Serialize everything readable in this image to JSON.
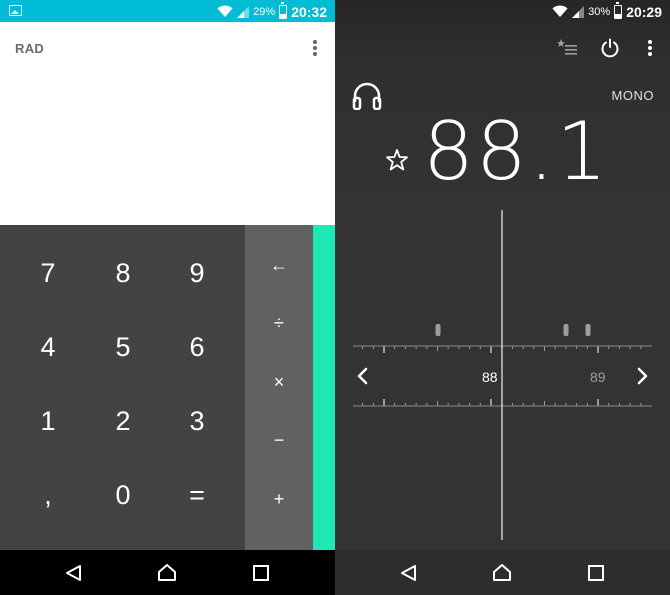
{
  "left_status": {
    "battery_pct": "29%",
    "time": "20:32",
    "battery_level": 0.29
  },
  "right_status": {
    "battery_pct": "30%",
    "time": "20:29",
    "battery_level": 0.3
  },
  "calculator": {
    "mode_label": "RAD",
    "keys": [
      [
        "7",
        "8",
        "9"
      ],
      [
        "4",
        "5",
        "6"
      ],
      [
        "1",
        "2",
        "3"
      ],
      [
        ",",
        "0",
        "="
      ]
    ],
    "operators": [
      "←",
      "÷",
      "×",
      "−",
      "+"
    ],
    "colors": {
      "status_bar": "#00bcd4",
      "pad": "#434343",
      "ops": "#616161",
      "advanced_panel": "#1de9b6"
    }
  },
  "radio": {
    "audio_mode": "MONO",
    "frequency": "88.1",
    "tick_labels": [
      "88",
      "89"
    ],
    "icons": [
      "favorites-list-icon",
      "power-icon",
      "more-options-icon",
      "headphone-icon",
      "favorite-star-icon",
      "chevron-left-icon",
      "chevron-right-icon"
    ]
  },
  "nav": {
    "buttons": [
      "back",
      "home",
      "recents"
    ]
  }
}
